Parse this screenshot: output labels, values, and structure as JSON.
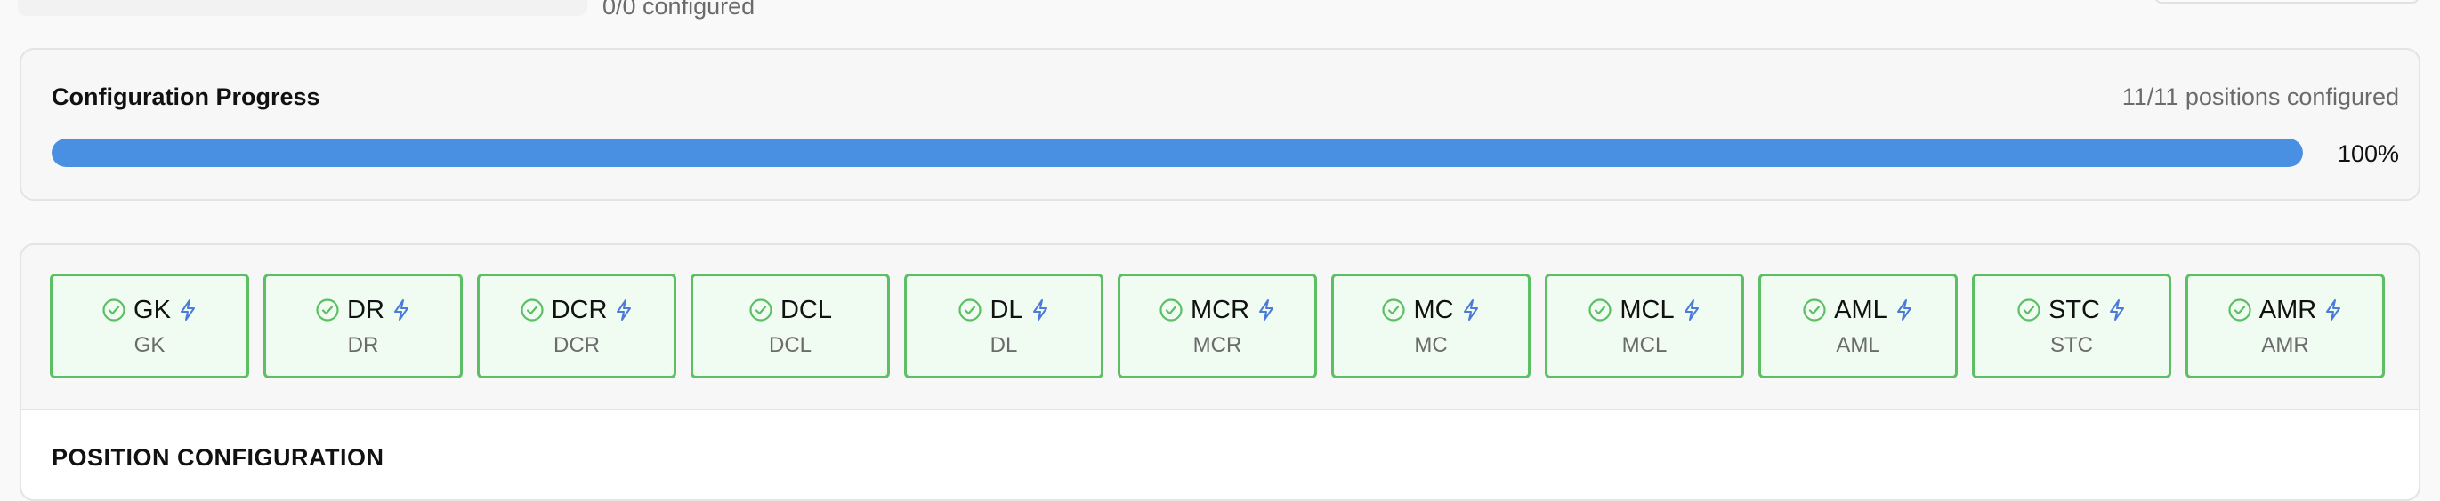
{
  "top": {
    "configured_text": "0/0 configured"
  },
  "progress": {
    "title": "Configuration Progress",
    "count_text": "11/11 positions configured",
    "percent_text": "100%",
    "fraction": 1.0,
    "color": "#4a90e2"
  },
  "positions": [
    {
      "code": "GK",
      "label": "GK",
      "auto": true
    },
    {
      "code": "DR",
      "label": "DR",
      "auto": true
    },
    {
      "code": "DCR",
      "label": "DCR",
      "auto": true
    },
    {
      "code": "DCL",
      "label": "DCL",
      "auto": false
    },
    {
      "code": "DL",
      "label": "DL",
      "auto": true
    },
    {
      "code": "MCR",
      "label": "MCR",
      "auto": true
    },
    {
      "code": "MC",
      "label": "MC",
      "auto": true
    },
    {
      "code": "MCL",
      "label": "MCL",
      "auto": true
    },
    {
      "code": "AML",
      "label": "AML",
      "auto": true
    },
    {
      "code": "STC",
      "label": "STC",
      "auto": true
    },
    {
      "code": "AMR",
      "label": "AMR",
      "auto": true
    }
  ],
  "icons": {
    "status": "check-circle-icon",
    "auto": "lightning-icon"
  },
  "colors": {
    "configured_border": "#5cbf64",
    "configured_bg": "#f0fbf2",
    "lightning": "#4a7bd8"
  },
  "section": {
    "title": "POSITION CONFIGURATION"
  }
}
